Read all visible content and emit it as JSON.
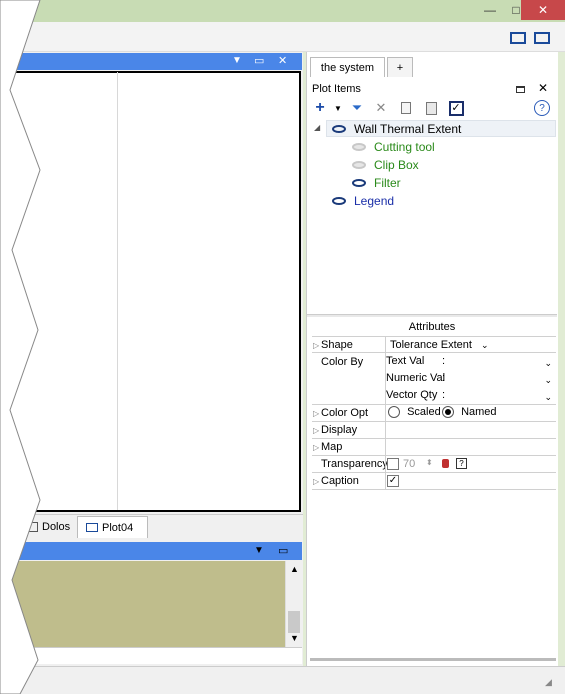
{
  "window": {
    "minimize": "—",
    "maximize": "□",
    "close": "✕"
  },
  "plot_panel": {
    "menu": "▼",
    "restore": "▭",
    "close": "✕"
  },
  "bottom_tabs": [
    {
      "label": "Dolos"
    },
    {
      "label": "Plot04"
    }
  ],
  "log_panel": {
    "menu": "▼",
    "restore": "▭"
  },
  "right_tabs": [
    {
      "label": "the system"
    },
    {
      "label": "+"
    }
  ],
  "plot_items": {
    "title": "Plot Items",
    "help": "?",
    "tree": [
      {
        "label": "Wall Thermal Extent",
        "color": "#000000"
      },
      {
        "label": "Cutting tool",
        "color": "#2a8a1a"
      },
      {
        "label": "Clip Box",
        "color": "#2a8a1a"
      },
      {
        "label": "Filter",
        "color": "#2a8a1a"
      },
      {
        "label": "Legend",
        "color": "#1a2ea8"
      }
    ]
  },
  "attributes": {
    "title": "Attributes",
    "shape": {
      "label": "Shape",
      "value": "Tolerance Extent"
    },
    "color_by": {
      "label": "Color By",
      "text_val": "Text Val",
      "numeric_val": "Numeric Val",
      "vector_qty": "Vector Qty",
      "colon": ":"
    },
    "color_opt": {
      "label": "Color Opt",
      "scaled": "Scaled",
      "named": "Named",
      "selected": "Named"
    },
    "display": {
      "label": "Display"
    },
    "map": {
      "label": "Map"
    },
    "transparency": {
      "label": "Transparency",
      "value": "70"
    },
    "caption": {
      "label": "Caption",
      "checked": true
    }
  },
  "scroll": {
    "up": "▲",
    "down": "▼"
  },
  "colors": {
    "accent": "#4a86e8",
    "log_bg": "#bfbd8c",
    "frame": "#c8dcb4"
  }
}
